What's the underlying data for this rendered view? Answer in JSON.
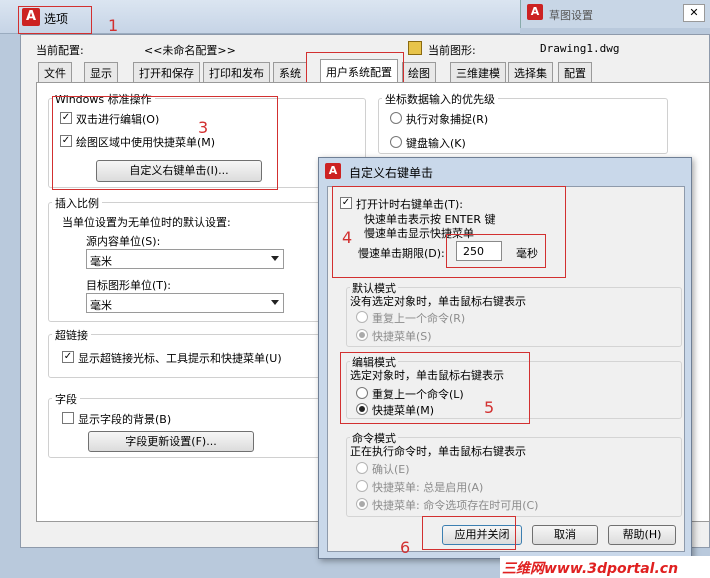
{
  "background_window": {
    "title": "草图设置",
    "close": "✕"
  },
  "options": {
    "title": "选项",
    "current_profile_label": "当前配置:",
    "current_profile_value": "<<未命名配置>>",
    "current_drawing_label": "当前图形:",
    "current_drawing_value": "Drawing1.dwg",
    "tabs": [
      "文件",
      "显示",
      "打开和保存",
      "打印和发布",
      "系统",
      "用户系统配置",
      "绘图",
      "三维建模",
      "选择集",
      "配置"
    ],
    "windows_group": {
      "title": "Windows 标准操作",
      "double_click_edit": "双击进行编辑(O)",
      "shortcut_menu": "绘图区域中使用快捷菜单(M)",
      "custom_right_click_button": "自定义右键单击(I)..."
    },
    "insert_scale": {
      "title": "插入比例",
      "desc": "当单位设置为无单位时的默认设置:",
      "source_label": "源内容单位(S):",
      "source_value": "毫米",
      "target_label": "目标图形单位(T):",
      "target_value": "毫米"
    },
    "hyperlink": {
      "title": "超链接",
      "show_cursor": "显示超链接光标、工具提示和快捷菜单(U)"
    },
    "fields": {
      "title": "字段",
      "show_background": "显示字段的背景(B)",
      "update_button": "字段更新设置(F)..."
    },
    "coord_priority": {
      "title": "坐标数据输入的优先级",
      "osnap": "执行对象捕捉(R)",
      "keyboard": "键盘输入(K)"
    }
  },
  "dialog": {
    "title": "自定义右键单击",
    "timed_right_click": "打开计时右键单击(T):",
    "quick_click": "快速单击表示按 ENTER 键",
    "slow_click": "慢速单击显示快捷菜单",
    "slow_duration_label": "慢速单击期限(D):",
    "slow_duration_value": "250",
    "slow_duration_unit": "毫秒",
    "default_mode": {
      "title": "默认模式",
      "desc": "没有选定对象时，单击鼠标右键表示",
      "repeat_last": "重复上一个命令(R)",
      "shortcut_menu": "快捷菜单(S)"
    },
    "edit_mode": {
      "title": "编辑模式",
      "desc": "选定对象时，单击鼠标右键表示",
      "repeat_last": "重复上一个命令(L)",
      "shortcut_menu": "快捷菜单(M)"
    },
    "command_mode": {
      "title": "命令模式",
      "desc": "正在执行命令时，单击鼠标右键表示",
      "enter": "确认(E)",
      "shortcut_always": "快捷菜单: 总是启用(A)",
      "shortcut_options": "快捷菜单: 命令选项存在时可用(C)"
    },
    "apply_close": "应用并关闭",
    "cancel": "取消",
    "help": "帮助(H)"
  },
  "annotations": [
    "1",
    "2",
    "3",
    "4",
    "5",
    "6"
  ],
  "watermark": "三维网www.3dportal.cn",
  "colors": {
    "annotation": "#d23030",
    "titlebar": "#c6d4e6",
    "dialog_frame": "#c9d8ea"
  }
}
